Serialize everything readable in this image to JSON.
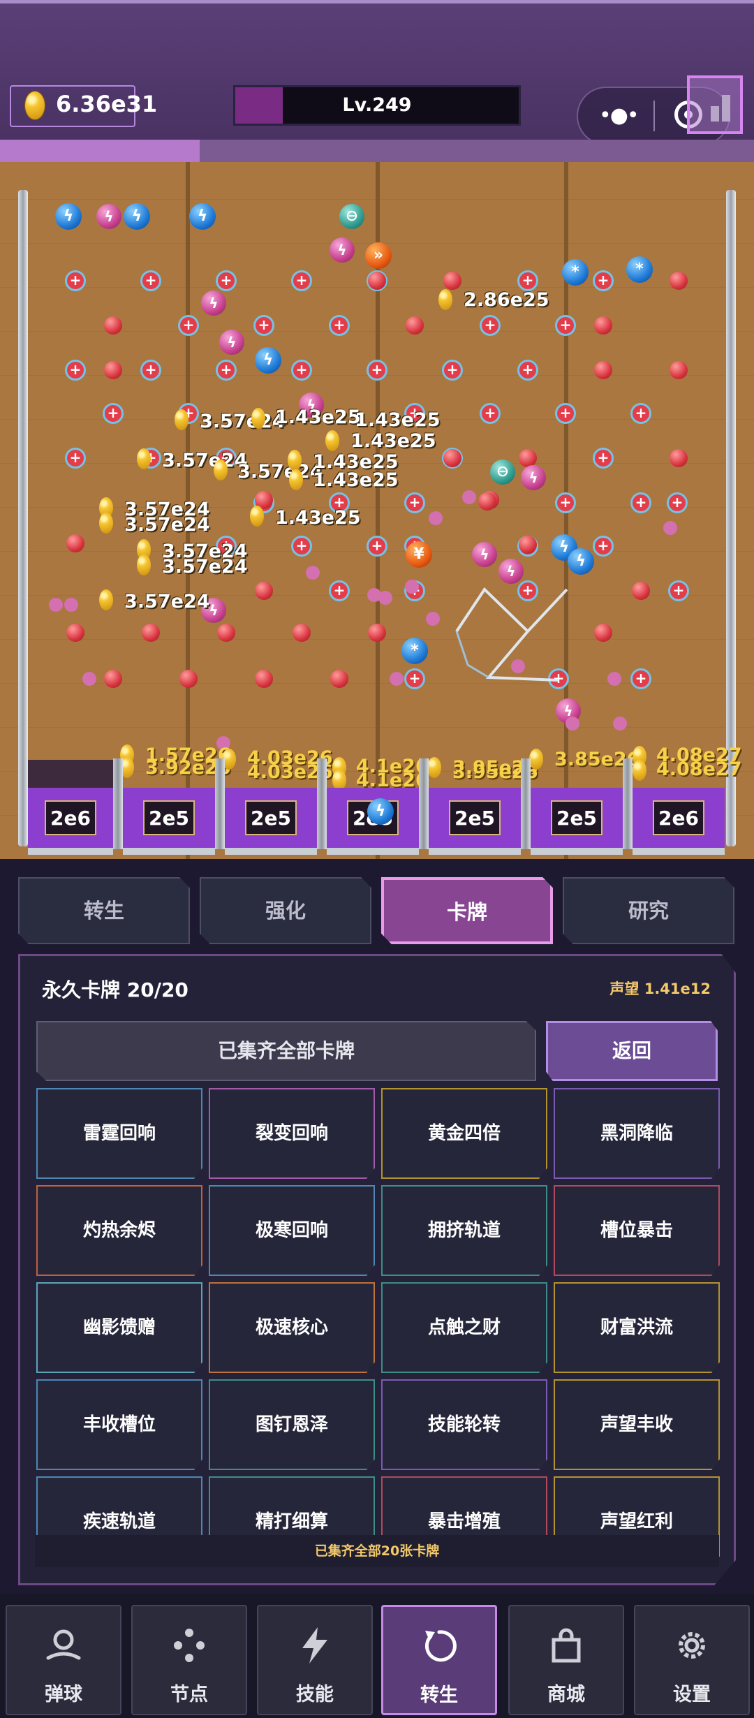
{
  "header": {
    "money": "6.36e31",
    "level": "Lv.249",
    "icons": {
      "coin": "gold-coin-icon",
      "more": "more-dots-icon",
      "close": "close-target-icon",
      "stats": "bar-chart-icon"
    }
  },
  "board": {
    "floating_values": [
      {
        "text": "2.86e25"
      },
      {
        "text": "3.57e24"
      },
      {
        "text": "1.43e25"
      },
      {
        "text": "1.43e25"
      },
      {
        "text": "1.43e25"
      },
      {
        "text": "3.57e24"
      },
      {
        "text": "3.57e24"
      },
      {
        "text": "1.43e25"
      },
      {
        "text": "1.43e25"
      },
      {
        "text": "3.57e24"
      },
      {
        "text": "3.57e24"
      },
      {
        "text": "1.43e25"
      },
      {
        "text": "3.57e24"
      },
      {
        "text": "3.57e24"
      },
      {
        "text": "3.57e24"
      }
    ],
    "slot_values": [
      {
        "text": "1.57e26"
      },
      {
        "text": "3.92e26"
      },
      {
        "text": "4.03e26"
      },
      {
        "text": "4.03e26"
      },
      {
        "text": "4.1e26"
      },
      {
        "text": "4.1e26"
      },
      {
        "text": "3.95e26"
      },
      {
        "text": "3.95e26"
      },
      {
        "text": "3.85e26"
      },
      {
        "text": "4.08e27"
      },
      {
        "text": "4.08e27"
      }
    ],
    "slots": [
      "2e6",
      "2e5",
      "2e5",
      "2e5",
      "2e5",
      "2e5",
      "2e6"
    ]
  },
  "tabs": [
    {
      "label": "转生"
    },
    {
      "label": "强化"
    },
    {
      "label": "卡牌",
      "active": true
    },
    {
      "label": "研究"
    }
  ],
  "panel": {
    "title": "永久卡牌 20/20",
    "prestige": "声望 1.41e12",
    "all_collected": "已集齐全部卡牌",
    "back": "返回",
    "footer_note": "已集齐全部20张卡牌",
    "cards": [
      {
        "name": "雷霆回响",
        "color": "#4d87b4"
      },
      {
        "name": "裂变回响",
        "color": "#a35aa8"
      },
      {
        "name": "黄金四倍",
        "color": "#b3932f"
      },
      {
        "name": "黑洞降临",
        "color": "#7b5ab2"
      },
      {
        "name": "灼热余烬",
        "color": "#c0613d"
      },
      {
        "name": "极寒回响",
        "color": "#4d87b4"
      },
      {
        "name": "拥挤轨道",
        "color": "#3e8d87"
      },
      {
        "name": "槽位暴击",
        "color": "#b3495e"
      },
      {
        "name": "幽影馈赠",
        "color": "#5ca4b8"
      },
      {
        "name": "极速核心",
        "color": "#c0713d"
      },
      {
        "name": "点触之财",
        "color": "#3e8d87"
      },
      {
        "name": "财富洪流",
        "color": "#b3932f"
      },
      {
        "name": "丰收槽位",
        "color": "#4d87b4"
      },
      {
        "name": "图钉恩泽",
        "color": "#3e8d87"
      },
      {
        "name": "技能轮转",
        "color": "#7b5ab2"
      },
      {
        "name": "声望丰收",
        "color": "#b3932f"
      },
      {
        "name": "疾速轨道",
        "color": "#4d87b4"
      },
      {
        "name": "精打细算",
        "color": "#3e8d87"
      },
      {
        "name": "暴击增殖",
        "color": "#b3495e"
      },
      {
        "name": "声望红利",
        "color": "#b3932f"
      }
    ]
  },
  "nav": [
    {
      "label": "弹球",
      "icon": "pinball-icon"
    },
    {
      "label": "节点",
      "icon": "nodes-icon"
    },
    {
      "label": "技能",
      "icon": "lightning-icon"
    },
    {
      "label": "转生",
      "icon": "rebirth-icon",
      "active": true
    },
    {
      "label": "商城",
      "icon": "shop-bag-icon"
    },
    {
      "label": "设置",
      "icon": "gear-icon"
    }
  ]
}
